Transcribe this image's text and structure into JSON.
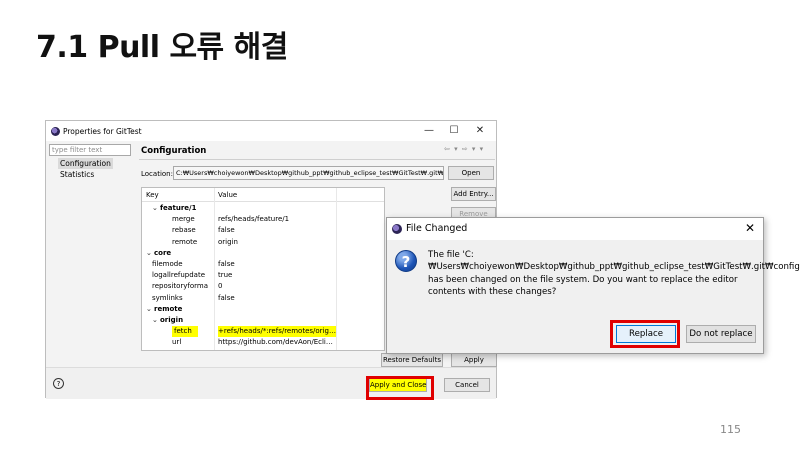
{
  "slide": {
    "title": "7.1 Pull 오류 해결",
    "page_number": "115"
  },
  "properties": {
    "window_title": "Properties for GitTest",
    "controls": {
      "minimize": "—",
      "maximize": "☐",
      "close": "✕"
    },
    "filter_placeholder": "type filter text",
    "nav": [
      "Configuration",
      "Statistics"
    ],
    "heading": "Configuration",
    "nav_arrows": "⇦ ▾ ⇨ ▾ ▾",
    "location_label": "Location:",
    "location_value": "C:₩Users₩choiyewon₩Desktop₩github_ppt₩github_eclipse_test₩GitTest₩.git₩config",
    "open_button": "Open",
    "add_entry_button": "Add Entry...",
    "remove_button": "Remove",
    "tree_headers": {
      "key": "Key",
      "value": "Value"
    },
    "tree": [
      {
        "key": "feature/1",
        "value": "",
        "level": 1,
        "bold": true,
        "expanded": true
      },
      {
        "key": "merge",
        "value": "refs/heads/feature/1",
        "level": 2
      },
      {
        "key": "rebase",
        "value": "false",
        "level": 2
      },
      {
        "key": "remote",
        "value": "origin",
        "level": 2
      },
      {
        "key": "core",
        "value": "",
        "level": 0,
        "bold": true,
        "expanded": true
      },
      {
        "key": "filemode",
        "value": "false",
        "level": 1
      },
      {
        "key": "logallrefupdate",
        "value": "true",
        "level": 1
      },
      {
        "key": "repositoryforma",
        "value": "0",
        "level": 1
      },
      {
        "key": "symlinks",
        "value": "false",
        "level": 1
      },
      {
        "key": "remote",
        "value": "",
        "level": 0,
        "bold": true,
        "expanded": true
      },
      {
        "key": "origin",
        "value": "",
        "level": 1,
        "bold": true,
        "expanded": true
      },
      {
        "key": "fetch",
        "value": "+refs/heads/*:refs/remotes/origin/*",
        "level": 2,
        "highlight": true
      },
      {
        "key": "url",
        "value": "https://github.com/devAon/Eclips...",
        "level": 2
      }
    ],
    "restore_defaults_button": "Restore Defaults",
    "apply_button": "Apply",
    "apply_close_button": "Apply and Close",
    "cancel_button": "Cancel",
    "help_icon": "?"
  },
  "dialog": {
    "title": "File Changed",
    "close": "✕",
    "icon": "?",
    "message": "The file 'C:₩Users₩choiyewon₩Desktop₩github_ppt₩github_eclipse_test₩GitTest₩.git₩config' has been changed on the file system. Do you want to replace the editor contents with these changes?",
    "replace_button": "Replace",
    "not_replace_button": "Do not replace"
  },
  "colors": {
    "highlight": "#ffff00",
    "callout_border": "#e00000",
    "focus_border": "#0078d7"
  }
}
